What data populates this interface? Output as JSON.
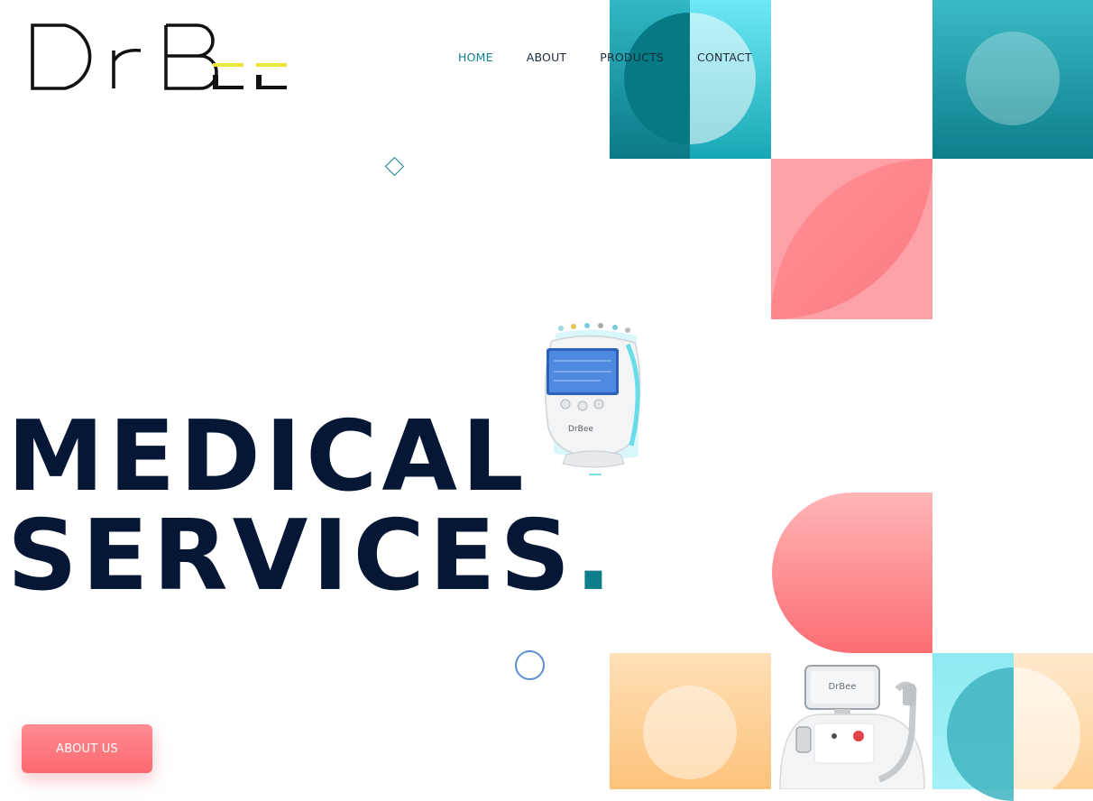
{
  "brand": {
    "logo_text": "DrBee",
    "accent_color": "#ede53a"
  },
  "nav": {
    "items": [
      {
        "label": "HOME",
        "active": true
      },
      {
        "label": "ABOUT",
        "active": false
      },
      {
        "label": "PRODUCTS",
        "active": false
      },
      {
        "label": "CONTACT",
        "active": false
      }
    ]
  },
  "hero": {
    "heading_line1": "MEDICAL",
    "heading_line2": "SERVICES",
    "heading_dot": ".",
    "cta_label": "ABOUT US",
    "device_brand": "DrBee",
    "machine_brand": "DrBee"
  },
  "colors": {
    "teal": "#0e7f8a",
    "navy": "#061735",
    "pink": "#fb6870",
    "orange": "#fcc27a",
    "ring_blue": "#5c8fd0"
  }
}
